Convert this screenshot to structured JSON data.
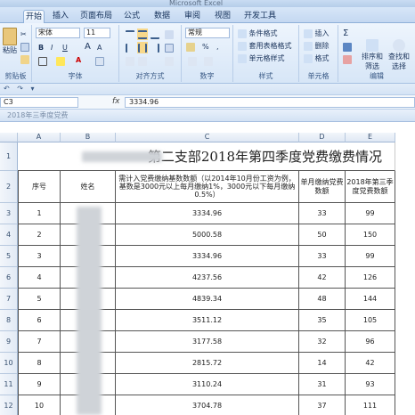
{
  "window_title": "Microsoft Excel",
  "tabs": [
    "开始",
    "插入",
    "页面布局",
    "公式",
    "数据",
    "审阅",
    "视图",
    "开发工具"
  ],
  "ribbon": {
    "paste_label": "粘贴",
    "font_name": "宋体",
    "font_size": "11",
    "bold": "B",
    "italic": "I",
    "underline": "U",
    "grow_font": "A",
    "shrink_font": "A",
    "font_color_glyph": "A",
    "number_format": "常规",
    "percent": "%",
    "comma": ",",
    "cond_format": "条件格式",
    "table_format": "套用表格格式",
    "cell_style": "单元格样式",
    "insert": "插入",
    "delete": "删除",
    "format": "格式",
    "sort_filter": "排序和\n筛选",
    "find_select": "查找和\n选择",
    "groups": [
      "剪贴板",
      "字体",
      "对齐方式",
      "数字",
      "样式",
      "单元格",
      "编辑"
    ]
  },
  "formula_bar": {
    "name_box": "C3",
    "fx": "fx",
    "value": "3334.96"
  },
  "sheet_title": "2018年三季度党费",
  "columns": [
    "A",
    "B",
    "C",
    "D",
    "E"
  ],
  "title_row": "第二支部2018年第四季度党费缴费情况",
  "headers": {
    "seq": "序号",
    "name": "姓名",
    "base": "需计入党费缴纳基数数额（以2014年10月份工资为例，基数是3000元以上每月缴纳1%，3000元以下每月缴纳0.5%）",
    "monthly": "单月缴纳党费数额",
    "quarter": "2018年第三季度党费数额"
  },
  "rows": [
    {
      "row": "3",
      "seq": "1",
      "base": "3334.96",
      "monthly": "33",
      "quarter": "99"
    },
    {
      "row": "4",
      "seq": "2",
      "base": "5000.58",
      "monthly": "50",
      "quarter": "150"
    },
    {
      "row": "5",
      "seq": "3",
      "base": "3334.96",
      "monthly": "33",
      "quarter": "99"
    },
    {
      "row": "6",
      "seq": "4",
      "base": "4237.56",
      "monthly": "42",
      "quarter": "126"
    },
    {
      "row": "7",
      "seq": "5",
      "base": "4839.34",
      "monthly": "48",
      "quarter": "144"
    },
    {
      "row": "8",
      "seq": "6",
      "base": "3511.12",
      "monthly": "35",
      "quarter": "105"
    },
    {
      "row": "9",
      "seq": "7",
      "base": "3177.58",
      "monthly": "32",
      "quarter": "96"
    },
    {
      "row": "10",
      "seq": "8",
      "base": "2815.72",
      "monthly": "14",
      "quarter": "42"
    },
    {
      "row": "11",
      "seq": "9",
      "base": "3110.24",
      "monthly": "31",
      "quarter": "93"
    },
    {
      "row": "12",
      "seq": "10",
      "base": "3704.78",
      "monthly": "37",
      "quarter": "111"
    }
  ],
  "row_numbers": [
    "1",
    "2"
  ]
}
